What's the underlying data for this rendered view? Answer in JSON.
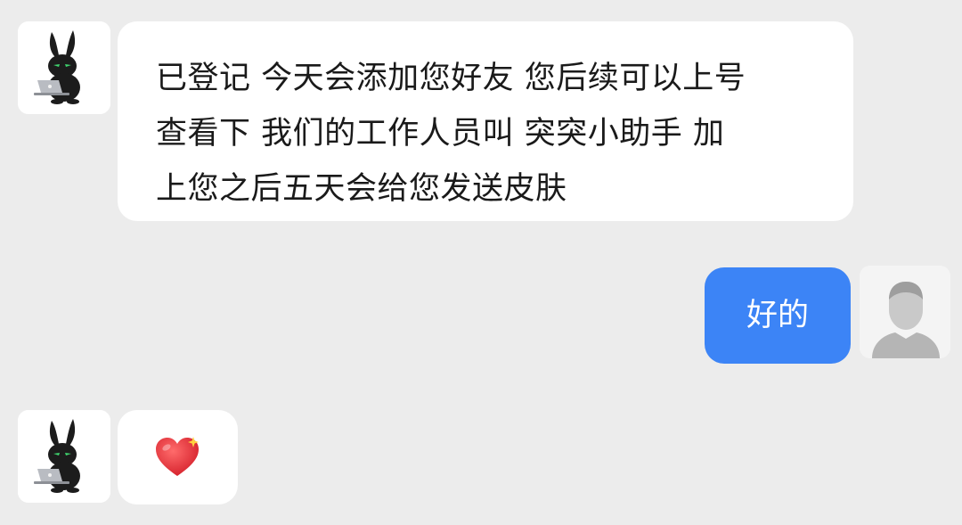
{
  "conversation": {
    "messages": [
      {
        "sender": "bot",
        "avatar_icon": "rabbit-with-laptop-avatar-icon",
        "text": "已登记 今天会添加您好友 您后续可以上号\n查看下 我们的工作人员叫 突突小助手 加\n上您之后五天会给您发送皮肤"
      },
      {
        "sender": "user",
        "avatar_icon": "default-user-avatar-icon",
        "text": "好的"
      },
      {
        "sender": "bot",
        "avatar_icon": "rabbit-with-laptop-avatar-icon",
        "emoji": "heart-sparkle-emoji-icon"
      }
    ]
  },
  "colors": {
    "background": "#ececec",
    "incoming_bubble": "#ffffff",
    "outgoing_bubble": "#3c84f6",
    "heart": "#e8323a"
  }
}
